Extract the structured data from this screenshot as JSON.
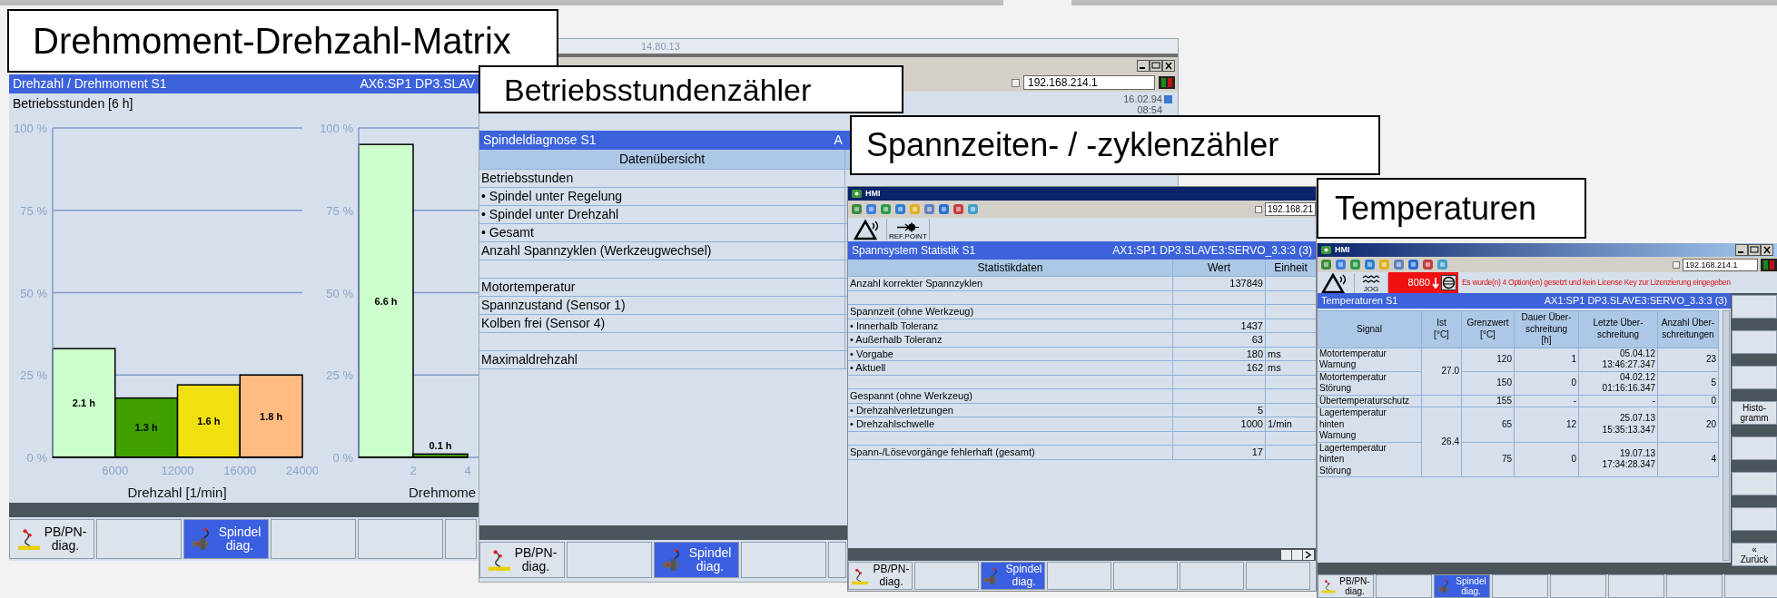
{
  "windows": [
    {
      "kind": "chart",
      "caption": "Drehmoment-Drehzahl-Matrix",
      "header": {
        "title": "Drehzahl / Drehmoment S1",
        "axis": "AX6:SP1 DP3.SLAV"
      },
      "subtitle": "Betriebsstunden [6 h]",
      "charts": [
        {
          "chart_data": {
            "type": "bar",
            "xlabel": "Drehzahl [1/min]",
            "categories": [
              "6000",
              "12000",
              "16000",
              "24000"
            ],
            "grid": true,
            "ylim": [
              0,
              100
            ],
            "yticks": [
              {
                "value": 100,
                "label": "100 %"
              },
              {
                "value": 75,
                "label": "75 %"
              },
              {
                "value": 50,
                "label": "50 %"
              },
              {
                "value": 25,
                "label": "25 %"
              },
              {
                "value": 0,
                "label": "0 %"
              }
            ],
            "series": [
              {
                "color": "#ccffcc",
                "values": [
                  33,
                  null,
                  null,
                  null
                ]
              },
              {
                "color": "#40a000",
                "values": [
                  null,
                  18,
                  null,
                  null
                ]
              },
              {
                "color": "#f0e010",
                "values": [
                  null,
                  null,
                  22,
                  null
                ]
              },
              {
                "color": "#ffbb80",
                "values": [
                  null,
                  null,
                  null,
                  25
                ]
              }
            ],
            "value_labels": [
              "2.1 h",
              "1.3 h",
              "1.6 h",
              "1.8 h"
            ]
          }
        },
        {
          "chart_data": {
            "type": "bar",
            "xlabel": "Drehmome",
            "categories": [
              "2",
              "4"
            ],
            "grid": true,
            "ylim": [
              0,
              100
            ],
            "yticks": [
              {
                "value": 100,
                "label": "100 %"
              },
              {
                "value": 75,
                "label": "75 %"
              },
              {
                "value": 50,
                "label": "50 %"
              },
              {
                "value": 25,
                "label": "25 %"
              },
              {
                "value": 0,
                "label": "0 %"
              }
            ],
            "series": [
              {
                "color": "#ccffcc",
                "values": [
                  95,
                  null
                ]
              },
              {
                "color": "#40a000",
                "values": [
                  null,
                  1
                ]
              }
            ],
            "value_labels": [
              "6.6 h",
              "0.1 h"
            ]
          }
        }
      ],
      "softkeys": [
        {
          "kind": "network",
          "label": "PB/PN-\ndiag.",
          "selected": false
        },
        {
          "kind": "blank",
          "selected": false
        },
        {
          "kind": "spindle",
          "label": "Spindel\ndiag.",
          "selected": true
        },
        {
          "kind": "blank",
          "selected": false
        },
        {
          "kind": "blank",
          "selected": false
        },
        {
          "kind": "blank",
          "selected": false
        }
      ]
    },
    {
      "kind": "overview",
      "caption": "Betriebsstundenzähler",
      "banner_date": "14.80.13",
      "ip_checked": false,
      "ip": "192.168.214.1",
      "date": "16.02.94",
      "time": "08:54",
      "header": {
        "title": "Spindeldiagnose S1",
        "axis": "A"
      },
      "table_title": "Datenübersicht",
      "rows": [
        {
          "kind": "text",
          "label": "Betriebsstunden"
        },
        {
          "kind": "text",
          "label": "• Spindel unter Regelung"
        },
        {
          "kind": "text",
          "label": "• Spindel unter Drehzahl"
        },
        {
          "kind": "text",
          "label": "• Gesamt"
        },
        {
          "kind": "text",
          "label": "Anzahl Spannzyklen (Werkzeugwechsel)"
        },
        {
          "kind": "blank"
        },
        {
          "kind": "text",
          "label": "Motortemperatur"
        },
        {
          "kind": "text",
          "label": "Spannzustand (Sensor 1)"
        },
        {
          "kind": "text",
          "label": "Kolben frei (Sensor 4)"
        },
        {
          "kind": "blank"
        },
        {
          "kind": "text",
          "label": "Maximaldrehzahl"
        }
      ],
      "softkeys": [
        {
          "kind": "network",
          "label": "PB/PN-\ndiag.",
          "selected": false
        },
        {
          "kind": "blank",
          "selected": false
        },
        {
          "kind": "spindle",
          "label": "Spindel\ndiag.",
          "selected": true
        },
        {
          "kind": "blank",
          "selected": false
        },
        {
          "kind": "blank",
          "selected": false
        }
      ]
    },
    {
      "kind": "statistics",
      "caption": "Spannzeiten- / -zyklenzähler",
      "app_title": "HMI",
      "ip_checked": false,
      "ip": "192.168.21",
      "ref_label": "REF.POINT",
      "header": {
        "title": "Spannsystem Statistik S1",
        "axis": "AX1:SP1 DP3.SLAVE3:SERVO_3.3:3 (3)"
      },
      "columns": [
        "Statistikdaten",
        "Wert",
        "Einheit"
      ],
      "rows": [
        {
          "kind": "text",
          "label": "Anzahl korrekter Spannzyklen",
          "value": "137849"
        },
        {
          "kind": "blank"
        },
        {
          "kind": "text",
          "label": "Spannzeit (ohne Werkzeug)"
        },
        {
          "kind": "text",
          "label": "• Innerhalb Toleranz",
          "value": "1437"
        },
        {
          "kind": "text",
          "label": "• Außerhalb Toleranz",
          "value": "63"
        },
        {
          "kind": "text",
          "label": "• Vorgabe",
          "value": "180",
          "unit": "ms"
        },
        {
          "kind": "text",
          "label": "• Aktuell",
          "value": "162",
          "unit": "ms"
        },
        {
          "kind": "blank"
        },
        {
          "kind": "text",
          "label": "Gespannt (ohne Werkzeug)"
        },
        {
          "kind": "text",
          "label": "• Drehzahlverletzungen",
          "value": "5"
        },
        {
          "kind": "text",
          "label": "• Drehzahlschwelle",
          "value": "1000",
          "unit": "1/min"
        },
        {
          "kind": "blank"
        },
        {
          "kind": "text",
          "label": "Spann-/Lösevorgänge fehlerhaft (gesamt)",
          "value": "17"
        }
      ],
      "softkeys": [
        {
          "kind": "network",
          "label": "PB/PN-\ndiag.",
          "selected": false
        },
        {
          "kind": "blank",
          "selected": false
        },
        {
          "kind": "spindle",
          "label": "Spindel\ndiag.",
          "selected": true
        },
        {
          "kind": "blank",
          "selected": false
        },
        {
          "kind": "blank",
          "selected": false
        },
        {
          "kind": "blank",
          "selected": false
        },
        {
          "kind": "blank",
          "selected": false
        }
      ]
    },
    {
      "kind": "temperatures",
      "caption": "Temperaturen",
      "app_title": "HMI",
      "ip_checked": false,
      "ip": "192.168.214.1",
      "jog_label": "JOG",
      "alarm_number": "8080",
      "message": "Es wurde(n) 4 Option(en) gesetzt und kein License Key zur Lizenzierung eingegeben",
      "header": {
        "title": "Temperaturen S1",
        "axis": "AX1:SP1 DP3.SLAVE3:SERVO_3.3:3 (3)"
      },
      "columns": [
        "Signal",
        "Ist\n[°C]",
        "Grenzwert\n[°C]",
        "Dauer Über-\nschreitung\n[h]",
        "Letzte Über-\nschreitung",
        "Anzahl Über-\nschreitungen"
      ],
      "groups": [
        {
          "ist": "27.0",
          "rows": [
            {
              "signal": "Motortemperatur\nWarnung",
              "limit": "120",
              "duration": "1",
              "last": "05.04.12\n13:46:27.347",
              "count": "23"
            },
            {
              "signal": "Motortemperatur\nStörung",
              "limit": "150",
              "duration": "0",
              "last": "04.02.12\n01:16:16.347",
              "count": "5"
            }
          ]
        },
        {
          "rows": [
            {
              "signal": "Übertemperaturschutz",
              "limit": "155",
              "duration": "-",
              "last": "-",
              "count": "0"
            }
          ]
        },
        {
          "ist": "26.4",
          "rows": [
            {
              "signal": "Lagertemperatur\nhinten\nWarnung",
              "limit": "65",
              "duration": "12",
              "last": "25.07.13\n15:35:13.347",
              "count": "20"
            },
            {
              "signal": "Lagertemperatur\nhinten\nStörung",
              "limit": "75",
              "duration": "0",
              "last": "19.07.13\n17:34:28.347",
              "count": "4"
            }
          ]
        }
      ],
      "side_softkeys": [
        {
          "kind": "blank"
        },
        {
          "kind": "blank"
        },
        {
          "kind": "blank"
        },
        {
          "kind": "text",
          "label": "Histo-\ngramm"
        },
        {
          "kind": "blank"
        },
        {
          "kind": "blank"
        },
        {
          "kind": "blank"
        },
        {
          "kind": "text",
          "label": "«\nZurück"
        }
      ],
      "softkeys": [
        {
          "kind": "network",
          "label": "PB/PN-\ndiag.",
          "selected": false
        },
        {
          "kind": "blank",
          "selected": false
        },
        {
          "kind": "spindle",
          "label": "Spindel\ndiag.",
          "selected": true
        },
        {
          "kind": "blank",
          "selected": false
        },
        {
          "kind": "blank",
          "selected": false
        },
        {
          "kind": "blank",
          "selected": false
        },
        {
          "kind": "blank",
          "selected": false
        },
        {
          "kind": "blank",
          "selected": false
        }
      ]
    }
  ]
}
